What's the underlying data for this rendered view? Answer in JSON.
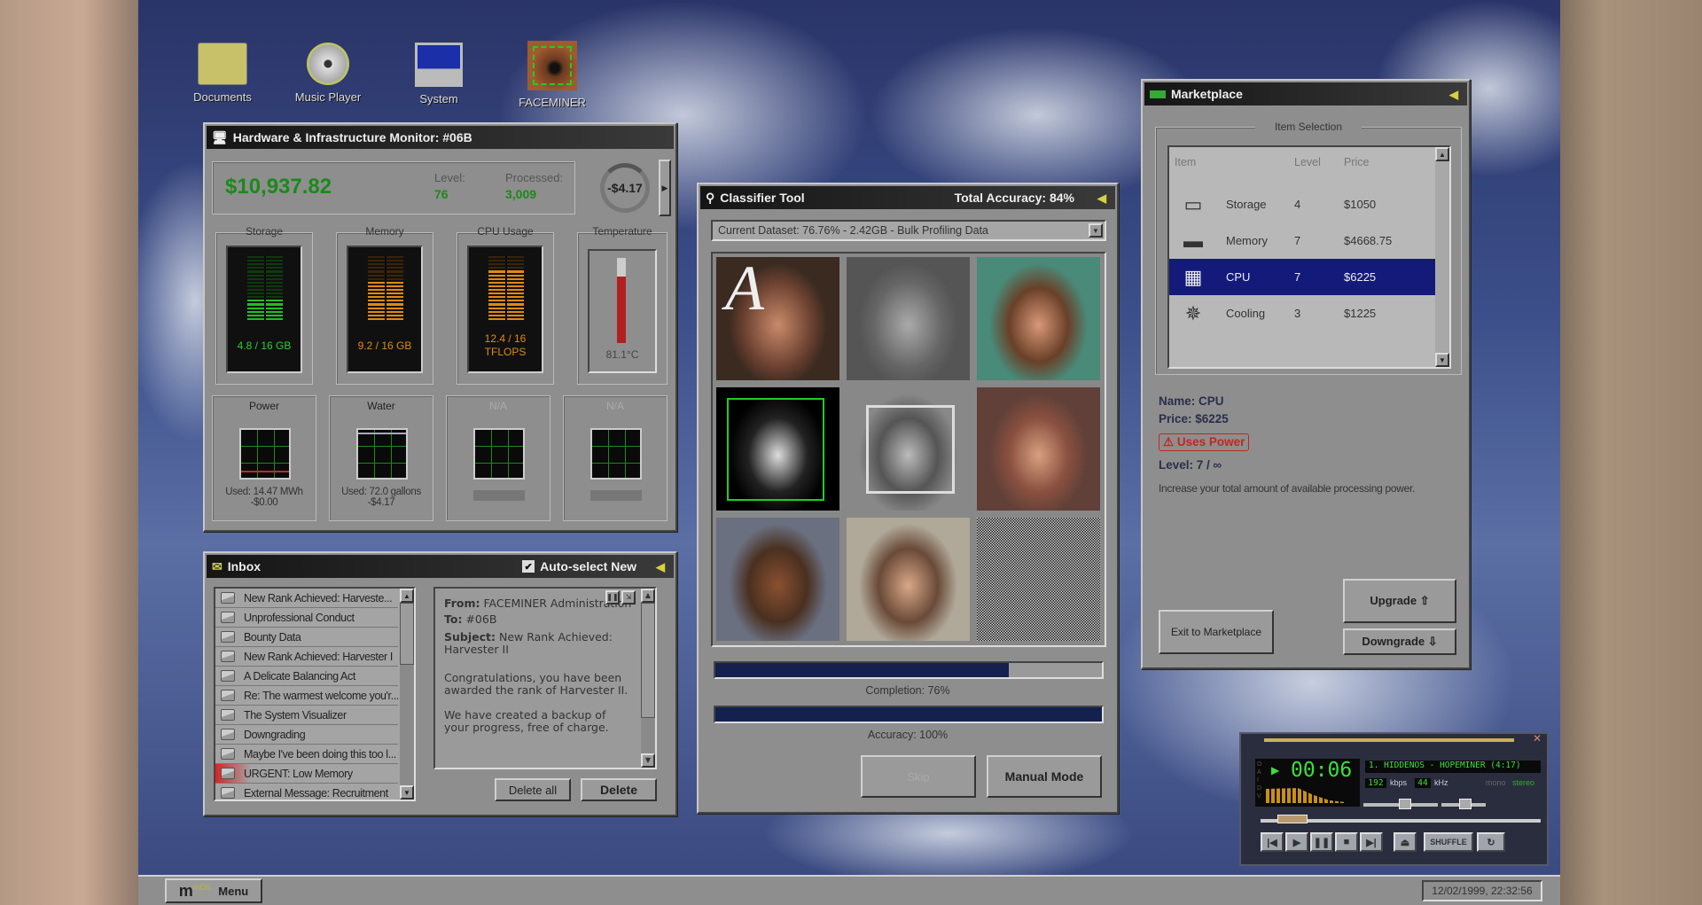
{
  "desktop": {
    "icons": [
      {
        "label": "Documents",
        "icon": "folder-icon"
      },
      {
        "label": "Music Player",
        "icon": "cd-icon"
      },
      {
        "label": "System",
        "icon": "computer-icon"
      },
      {
        "label": "FACEMINER",
        "icon": "eye-icon"
      }
    ]
  },
  "hardware": {
    "title": "Hardware & Infrastructure Monitor: #06B",
    "balance": "$10,937.82",
    "level_label": "Level:",
    "level": "76",
    "processed_label": "Processed:",
    "processed": "3,009",
    "rate": "-$4.17",
    "storage": {
      "label": "Storage",
      "value": "4.8 / 16 GB",
      "fill": 0.3
    },
    "memory": {
      "label": "Memory",
      "value": "9.2 / 16 GB",
      "fill": 0.575
    },
    "cpu": {
      "label": "CPU Usage",
      "value_line1": "12.4 / 16",
      "value_line2": "TFLOPS",
      "fill": 0.775
    },
    "temperature": {
      "label": "Temperature",
      "value": "81.1°C",
      "fill": 0.78
    },
    "power": {
      "label": "Power",
      "used": "Used: 14.47 MWh",
      "cost": "-$0.00"
    },
    "water": {
      "label": "Water",
      "used": "Used: 72.0 gallons",
      "cost": "-$4.17"
    },
    "slot3": {
      "label": "N/A"
    },
    "slot4": {
      "label": "N/A"
    }
  },
  "inbox": {
    "title": "Inbox",
    "auto_select_label": "Auto-select New",
    "auto_select": true,
    "messages": [
      "New Rank Achieved: Harveste...",
      "Unprofessional Conduct",
      "Bounty Data",
      "New Rank Achieved: Harvester I",
      "A Delicate Balancing Act",
      "Re: The warmest welcome you'r...",
      "The System Visualizer",
      "Downgrading",
      "Maybe I've been doing this too l...",
      "URGENT: Low Memory",
      "External Message: Recruitment"
    ],
    "urgent_index": 9,
    "reader": {
      "from_label": "From:",
      "from": "FACEMINER Administration",
      "to_label": "To:",
      "to": "#06B",
      "subject_label": "Subject:",
      "subject": "New Rank Achieved: Harvester II",
      "body1": "Congratulations, you have been awarded the rank of Harvester II.",
      "body2": "We have created a backup of your progress, free of charge."
    },
    "delete_all": "Delete all",
    "delete": "Delete"
  },
  "classifier": {
    "title": "Classifier Tool",
    "total_accuracy": "Total Accuracy: 84%",
    "dataset": "Current Dataset: 76.76% - 2.42GB - Bulk Profiling Data",
    "overlay_letter": "A",
    "completion_label": "Completion: 76%",
    "completion": 0.76,
    "accuracy_label": "Accuracy: 100%",
    "accuracy": 1.0,
    "skip": "Skip",
    "manual_mode": "Manual Mode"
  },
  "marketplace": {
    "title": "Marketplace",
    "group_label": "Item Selection",
    "columns": [
      "Item",
      "Level",
      "Price"
    ],
    "items": [
      {
        "name": "Storage",
        "level": "4",
        "price": "$1050",
        "icon": "hard-drive-icon"
      },
      {
        "name": "Memory",
        "level": "7",
        "price": "$4668.75",
        "icon": "memory-icon"
      },
      {
        "name": "CPU",
        "level": "7",
        "price": "$6225",
        "icon": "cpu-chip-icon"
      },
      {
        "name": "Cooling",
        "level": "3",
        "price": "$1225",
        "icon": "snowflake-icon"
      }
    ],
    "selected_index": 2,
    "detail_name": "Name: CPU",
    "detail_price": "Price: $6225",
    "warning": "⚠ Uses Power",
    "detail_level": "Level: 7 / ∞",
    "description": "Increase your total amount of available processing power.",
    "exit": "Exit to Marketplace",
    "upgrade": "Upgrade ⇧",
    "downgrade": "Downgrade ⇩"
  },
  "player": {
    "time": "00:06",
    "track": "1. HIDDENOS - HOPEMINER (4:17)",
    "kbps": "192",
    "kbps_label": "kbps",
    "khz": "44",
    "khz_label": "kHz",
    "mono": "mono",
    "stereo": "stereo",
    "shuffle": "SHUFFLE",
    "side_label": "OAIDV",
    "progress": 0.06
  },
  "taskbar": {
    "menu": "Menu",
    "logo": "mOS",
    "clock": "12/02/1999, 22:32:56"
  },
  "colors": {
    "green": "#1aa31a",
    "orange": "#e08a10",
    "selection": "#141a7a",
    "progress": "#14204e",
    "warning": "#c0281e"
  }
}
